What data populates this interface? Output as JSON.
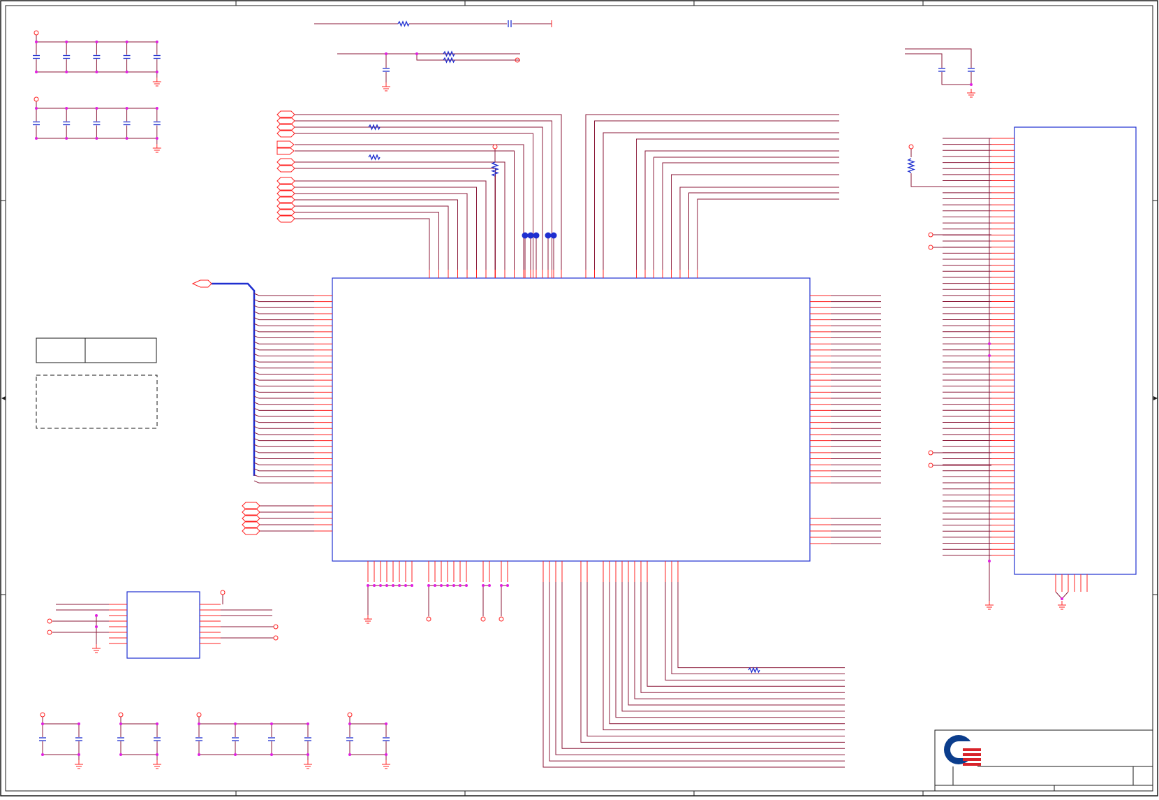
{
  "colors": {
    "wire": "#8b1a3a",
    "pin": "#ff2020",
    "body": "#1f2fd0",
    "junction": "#e020e0",
    "frame": "#1a1a1a",
    "logo_blue": "#0b3d8c",
    "logo_red": "#d8232a"
  },
  "icons": {
    "logo": "company-logo-icon",
    "ground": "ground-symbol-icon",
    "power": "power-port-icon",
    "capacitor": "capacitor-icon",
    "resistor": "resistor-icon",
    "net_port": "net-port-icon",
    "test_point": "test-point-icon"
  },
  "title_block": {
    "logo_text": ""
  }
}
